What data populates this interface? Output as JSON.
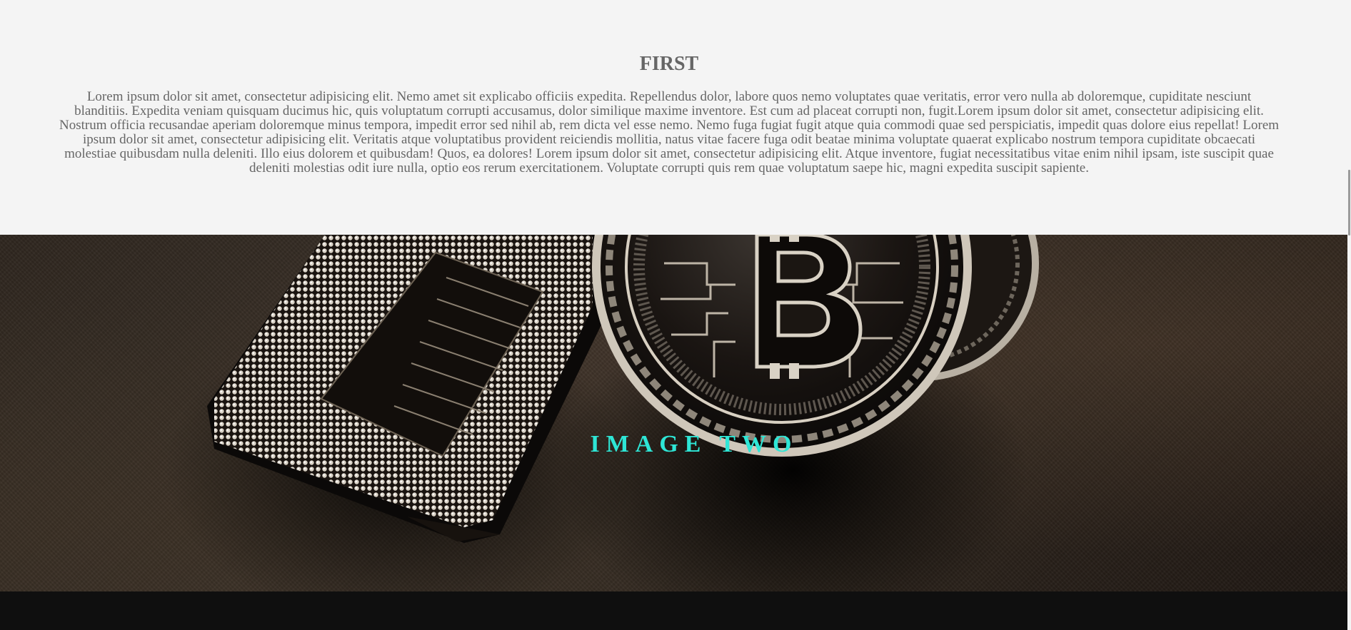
{
  "first_section": {
    "title": "FIRST",
    "body": "Lorem ipsum dolor sit amet, consectetur adipisicing elit. Nemo amet sit explicabo officiis expedita. Repellendus dolor, labore quos nemo voluptates quae veritatis, error vero nulla ab doloremque, cupiditate nesciunt blanditiis. Expedita veniam quisquam ducimus hic, quis voluptatum corrupti accusamus, dolor similique maxime inventore. Est cum ad placeat corrupti non, fugit.Lorem ipsum dolor sit amet, consectetur adipisicing elit. Nostrum officia recusandae aperiam doloremque minus tempora, impedit error sed nihil ab, rem dicta vel esse nemo. Nemo fuga fugiat fugit atque quia commodi quae sed perspiciatis, impedit quas dolore eius repellat! Lorem ipsum dolor sit amet, consectetur adipisicing elit. Veritatis atque voluptatibus provident reiciendis mollitia, natus vitae facere fuga odit beatae minima voluptate quaerat explicabo nostrum tempora cupiditate obcaecati molestiae quibusdam nulla deleniti. Illo eius dolorem et quibusdam! Quos, ea dolores! Lorem ipsum dolor sit amet, consectetur adipisicing elit. Atque inventore, fugiat necessitatibus vitae enim nihil ipsam, iste suscipit quae deleniti molestias odit iure nulla, optio eos rerum exercitationem. Voluptate corrupti quis rem quae voluptatum saepe hic, magni expedita suscipit sapiente."
  },
  "image_section": {
    "overlay_title": "IMAGE TWO",
    "image_subject": "bitcoin coin and cpu chip photo"
  },
  "colors": {
    "page_background": "#f4f4f4",
    "text_gray": "#666666",
    "accent_teal": "#2ee6d6",
    "footer_dark": "#0f0f0f"
  }
}
